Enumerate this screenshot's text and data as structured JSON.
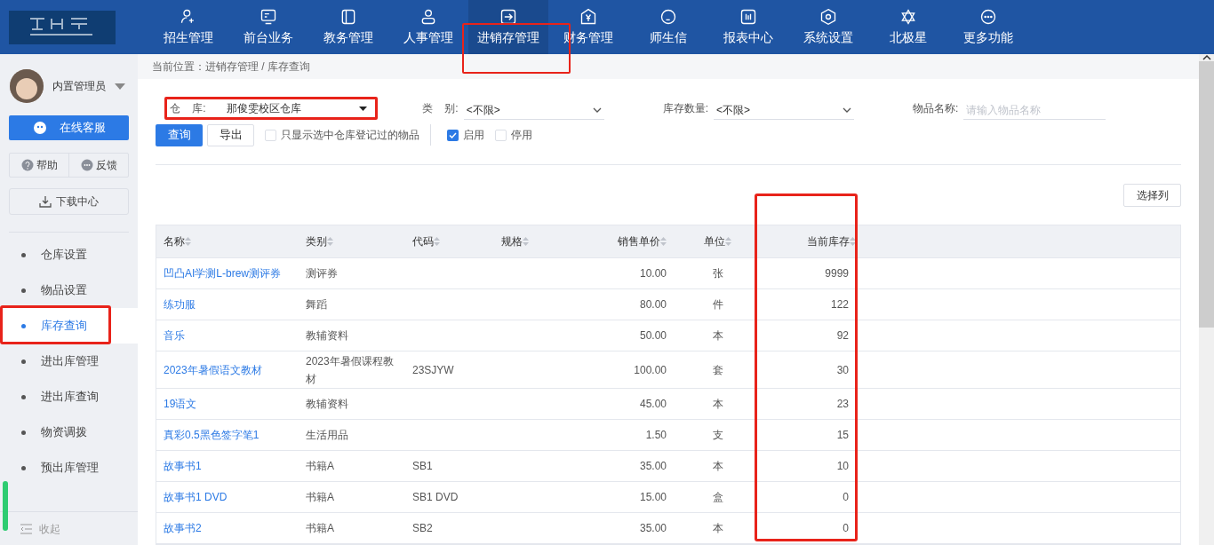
{
  "nav": [
    {
      "label": "招生管理",
      "selected": false,
      "highlighted": false
    },
    {
      "label": "前台业务",
      "selected": false,
      "highlighted": false
    },
    {
      "label": "教务管理",
      "selected": false,
      "highlighted": false
    },
    {
      "label": "人事管理",
      "selected": false,
      "highlighted": false
    },
    {
      "label": "进销存管理",
      "selected": true,
      "highlighted": true
    },
    {
      "label": "财务管理",
      "selected": false,
      "highlighted": false
    },
    {
      "label": "师生信",
      "selected": false,
      "highlighted": false
    },
    {
      "label": "报表中心",
      "selected": false,
      "highlighted": false
    },
    {
      "label": "系统设置",
      "selected": false,
      "highlighted": false
    },
    {
      "label": "北极星",
      "selected": false,
      "highlighted": false
    },
    {
      "label": "更多功能",
      "selected": false,
      "highlighted": false
    }
  ],
  "user": {
    "name": "内置管理员"
  },
  "sidebar": {
    "service_button": "在线客服",
    "help": "帮助",
    "feedback": "反馈",
    "download": "下载中心",
    "items": [
      {
        "label": "仓库设置",
        "selected": false,
        "highlighted": false
      },
      {
        "label": "物品设置",
        "selected": false,
        "highlighted": false
      },
      {
        "label": "库存查询",
        "selected": true,
        "highlighted": true
      },
      {
        "label": "进出库管理",
        "selected": false,
        "highlighted": false
      },
      {
        "label": "进出库查询",
        "selected": false,
        "highlighted": false
      },
      {
        "label": "物资调拨",
        "selected": false,
        "highlighted": false
      },
      {
        "label": "预出库管理",
        "selected": false,
        "highlighted": false
      }
    ],
    "collapse": "收起"
  },
  "breadcrumb": "当前位置：进销存管理 / 库存查询",
  "filters": {
    "warehouse": {
      "label": "仓    库:",
      "value": "那俊雯校区仓库",
      "highlighted": true
    },
    "category": {
      "label": "类    别:",
      "value": "<不限>"
    },
    "quantity": {
      "label": "库存数量:",
      "value": "<不限>"
    },
    "item_name": {
      "label": "物品名称:",
      "placeholder": "请输入物品名称"
    }
  },
  "buttons": {
    "query": "查询",
    "export": "导出",
    "choose_columns": "选择列"
  },
  "checks": [
    {
      "label": "只显示选中仓库登记过的物品",
      "checked": false
    },
    {
      "label": "启用",
      "checked": true
    },
    {
      "label": "停用",
      "checked": false
    }
  ],
  "table": {
    "columns": [
      {
        "label": "名称",
        "highlighted": false
      },
      {
        "label": "类别",
        "highlighted": false
      },
      {
        "label": "代码",
        "highlighted": false
      },
      {
        "label": "规格",
        "highlighted": false
      },
      {
        "label": "销售单价",
        "highlighted": false
      },
      {
        "label": "单位",
        "highlighted": false
      },
      {
        "label": "当前库存",
        "highlighted": true
      }
    ],
    "rows": [
      [
        "凹凸AI学测L-brew测评券",
        "测评券",
        "",
        "",
        "10.00",
        "张",
        "9999"
      ],
      [
        "练功服",
        "舞蹈",
        "",
        "",
        "80.00",
        "件",
        "122"
      ],
      [
        "音乐",
        "教辅资料",
        "",
        "",
        "50.00",
        "本",
        "92"
      ],
      [
        "2023年暑假语文教材",
        "2023年暑假课程教材",
        "23SJYW",
        "",
        "100.00",
        "套",
        "30"
      ],
      [
        "19语文",
        "教辅资料",
        "",
        "",
        "45.00",
        "本",
        "23"
      ],
      [
        "真彩0.5黑色签字笔1",
        "生活用品",
        "",
        "",
        "1.50",
        "支",
        "15"
      ],
      [
        "故事书1",
        "书籍A",
        "SB1",
        "",
        "35.00",
        "本",
        "10"
      ],
      [
        "故事书1 DVD",
        "书籍A",
        "SB1 DVD",
        "",
        "15.00",
        "盒",
        "0"
      ],
      [
        "故事书2",
        "书籍A",
        "SB2",
        "",
        "35.00",
        "本",
        "0"
      ]
    ]
  }
}
